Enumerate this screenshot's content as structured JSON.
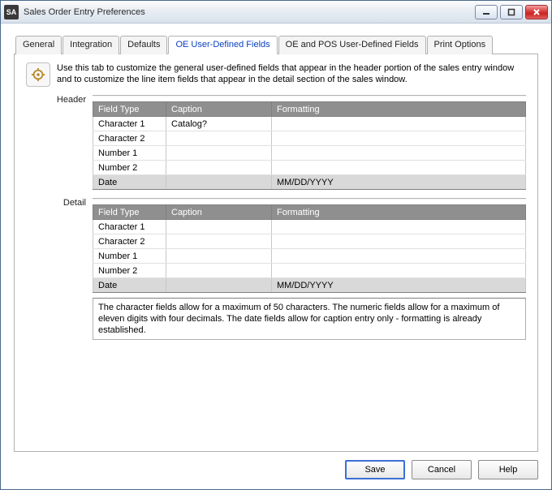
{
  "window": {
    "appIconText": "SA",
    "title": "Sales Order Entry Preferences"
  },
  "tabs": [
    {
      "label": "General"
    },
    {
      "label": "Integration"
    },
    {
      "label": "Defaults"
    },
    {
      "label": "OE User-Defined Fields",
      "active": true
    },
    {
      "label": "OE and POS User-Defined Fields"
    },
    {
      "label": "Print Options"
    }
  ],
  "intro": "Use this tab to customize the general user-defined fields that appear in the header portion of the sales entry window and to customize the line item fields that appear in the detail section of the sales window.",
  "columns": {
    "fieldType": "Field Type",
    "caption": "Caption",
    "formatting": "Formatting"
  },
  "sections": {
    "header": {
      "label": "Header",
      "rows": [
        {
          "fieldType": "Character 1",
          "caption": "Catalog?",
          "formatting": ""
        },
        {
          "fieldType": "Character 2",
          "caption": "",
          "formatting": ""
        },
        {
          "fieldType": "Number 1",
          "caption": "",
          "formatting": ""
        },
        {
          "fieldType": "Number 2",
          "caption": "",
          "formatting": ""
        },
        {
          "fieldType": "Date",
          "caption": "",
          "formatting": "MM/DD/YYYY",
          "dim": true
        }
      ]
    },
    "detail": {
      "label": "Detail",
      "rows": [
        {
          "fieldType": "Character 1",
          "caption": "",
          "formatting": ""
        },
        {
          "fieldType": "Character 2",
          "caption": "",
          "formatting": ""
        },
        {
          "fieldType": "Number 1",
          "caption": "",
          "formatting": ""
        },
        {
          "fieldType": "Number 2",
          "caption": "",
          "formatting": ""
        },
        {
          "fieldType": "Date",
          "caption": "",
          "formatting": "MM/DD/YYYY",
          "dim": true
        }
      ]
    }
  },
  "footnote": "The character fields allow for a maximum of 50 characters.  The numeric fields allow for a maximum of eleven digits with four decimals.  The date fields allow for caption entry only - formatting is already established.",
  "buttons": {
    "save": "Save",
    "cancel": "Cancel",
    "help": "Help"
  }
}
